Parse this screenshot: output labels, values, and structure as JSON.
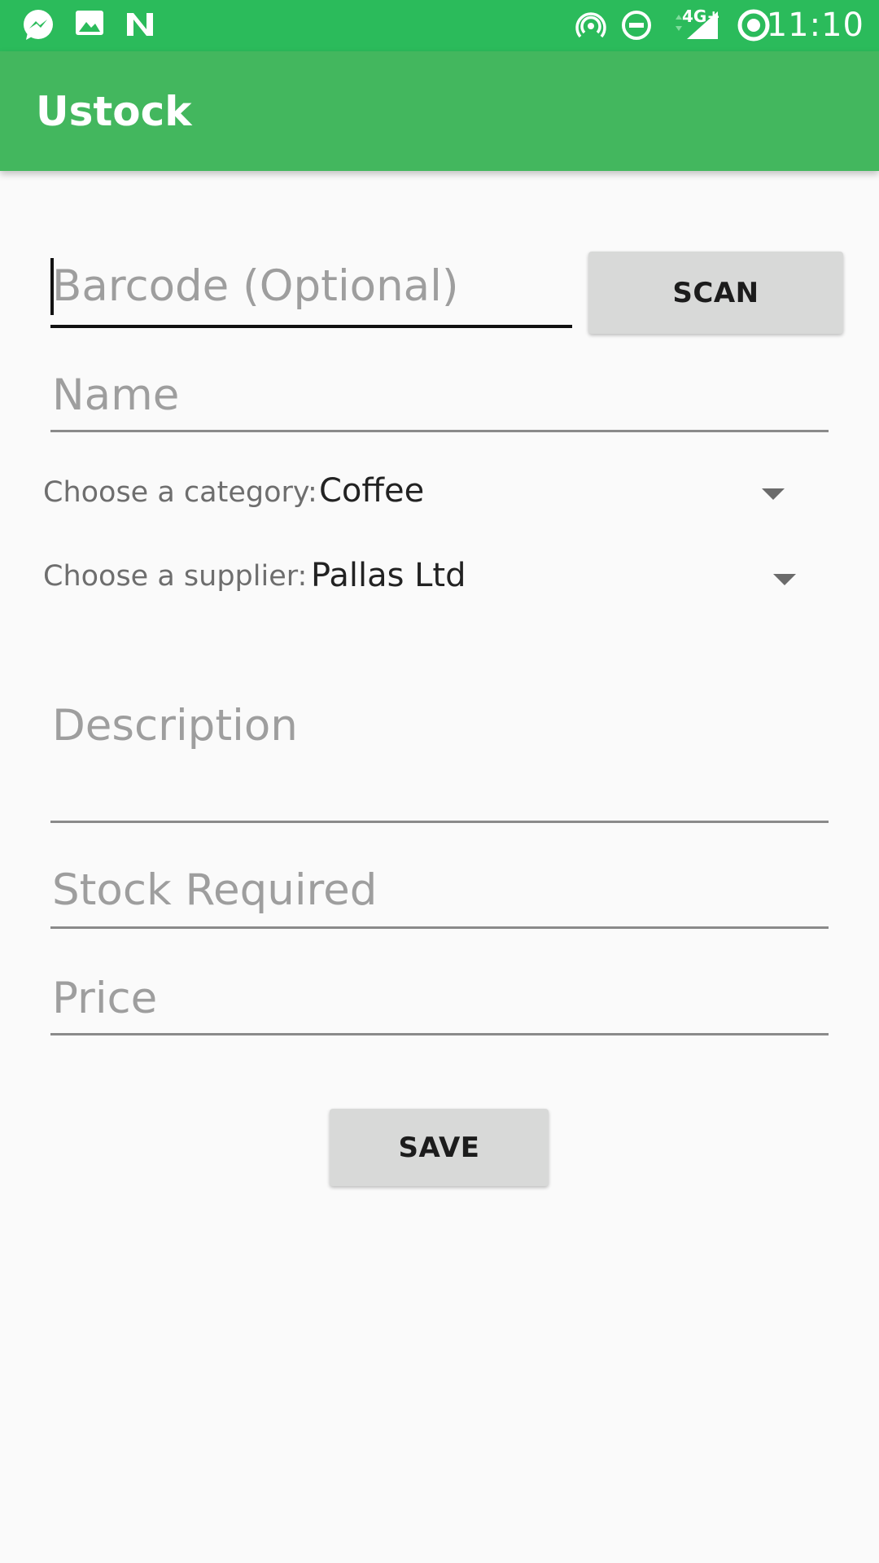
{
  "status_bar": {
    "time": "11:10",
    "network": "4G+",
    "icons": [
      "messenger-icon",
      "image-icon",
      "n-app-icon",
      "hotspot-icon",
      "dnd-icon",
      "signal-icon",
      "sync-icon"
    ]
  },
  "app_bar": {
    "title": "Ustock",
    "color": "#43b75e"
  },
  "form": {
    "barcode": {
      "placeholder": "Barcode (Optional)",
      "value": ""
    },
    "scan_button": "SCAN",
    "name": {
      "placeholder": "Name",
      "value": ""
    },
    "category": {
      "label": "Choose a category:",
      "selected": "Coffee"
    },
    "supplier": {
      "label": "Choose a supplier:",
      "selected": "Pallas Ltd"
    },
    "description": {
      "placeholder": "Description",
      "value": ""
    },
    "stock_required": {
      "placeholder": "Stock Required",
      "value": ""
    },
    "price": {
      "placeholder": "Price",
      "value": ""
    },
    "save_button": "SAVE"
  }
}
